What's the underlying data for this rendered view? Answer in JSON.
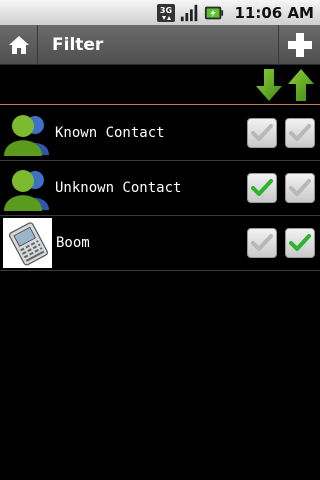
{
  "status_bar": {
    "network_icon": "3g-icon",
    "signal_icon": "signal-icon",
    "battery_icon": "battery-charging-icon",
    "time": "11:06 AM"
  },
  "title_bar": {
    "title": "Filter",
    "home_icon": "home-icon",
    "add_icon": "plus-icon"
  },
  "sort": {
    "down_icon": "arrow-down-icon",
    "up_icon": "arrow-up-icon",
    "color": "#6cae20"
  },
  "contacts": [
    {
      "name": "Known Contact",
      "avatar": "contact-avatar-icon",
      "checked_first": false,
      "checked_second": false
    },
    {
      "name": "Unknown Contact",
      "avatar": "contact-avatar-icon",
      "checked_first": true,
      "checked_second": false
    },
    {
      "name": "Boom",
      "avatar": "phone-photo",
      "checked_first": false,
      "checked_second": true
    }
  ],
  "colors": {
    "check_on": "#2db52d",
    "check_off": "#b8b8b8",
    "accent_line": "#c87a4a"
  }
}
